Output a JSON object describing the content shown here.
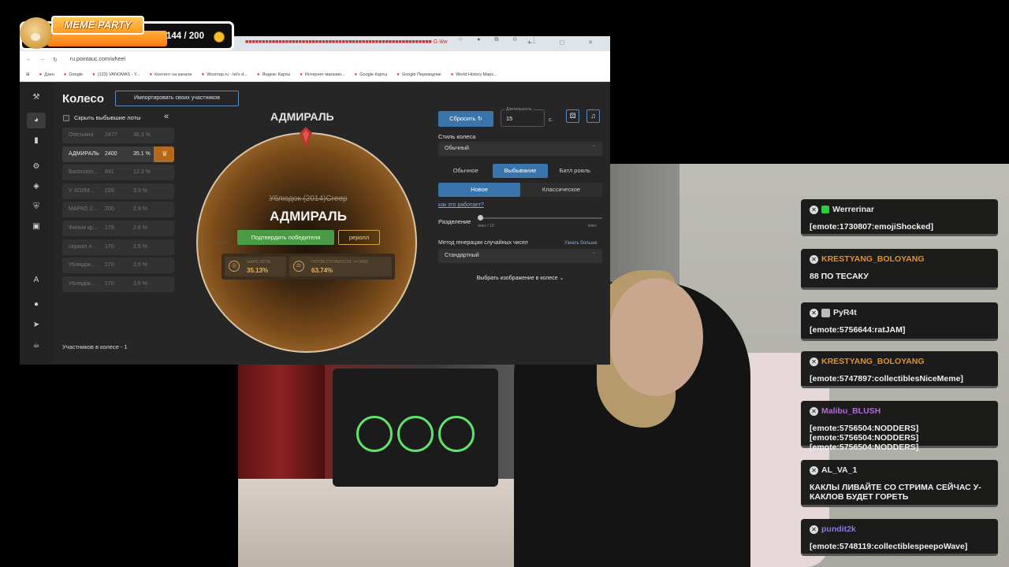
{
  "overlay": {
    "meme_party": {
      "title": "MEME PARTY",
      "score": "144 / 200"
    }
  },
  "browser": {
    "tabs_strip": "■■■■■■■■■■■■■■■■■■■■■■■■■■■■■■■■■■■■■■■■■■■■■■■■■■■■■■■■ G·ww",
    "new_tab": "+",
    "window_buttons": "— ▢ ✕",
    "url": "ru.pointauc.com/wheel",
    "toolbar_icons": "⋯ ☆ ● ⧉ ⊙ ⋮",
    "bookmarks": [
      "Дзен",
      "Google",
      "(123) VANOMAS - Y...",
      "Контент на канале",
      "Wozmap.ru - let's d...",
      "Яндекс Карты",
      "Интернет-магазин...",
      "Google Карты",
      "Google Переводчик",
      "World History Maps..."
    ]
  },
  "app": {
    "title": "Колесо",
    "import_button": "Импортировать своих участников",
    "hide_dropped": "Скрыть выбывшие лоты",
    "collapse": "«",
    "lots": [
      {
        "name": "Обезьяна",
        "amount": "2477",
        "percent": "36.3 %",
        "dropped": true
      },
      {
        "name": "АДМИРАЛЬ",
        "amount": "2400",
        "percent": "35.1 %",
        "dropped": false
      },
      {
        "name": "Backroom...",
        "amount": "841",
        "percent": "12.3 %",
        "dropped": true
      },
      {
        "name": "У ХОЛМ...",
        "amount": "228",
        "percent": "3.3 %",
        "dropped": true
      },
      {
        "name": "МАРКО 2...",
        "amount": "200",
        "percent": "2.9 %",
        "dropped": true
      },
      {
        "name": "Фильм кр...",
        "amount": "179",
        "percent": "2.6 %",
        "dropped": true
      },
      {
        "name": "сериал л...",
        "amount": "170",
        "percent": "2.5 %",
        "dropped": true
      },
      {
        "name": "Ублюдок...",
        "amount": "170",
        "percent": "2.5 %",
        "dropped": true
      },
      {
        "name": "Ублюдок...",
        "amount": "170",
        "percent": "2.5 %",
        "dropped": true
      }
    ],
    "participants_count": "Участников в колесе - 1",
    "wheel": {
      "winner_title": "АДМИРАЛЬ",
      "previous": "Ублюдок (2014)Creep",
      "winner_name": "АДМИРАЛЬ",
      "confirm_button": "Подтвердить победителя",
      "reroll_button": "реролл",
      "side_label": "ЧАЛМИ...",
      "lot_chance_label": "ШАНС ЛОТА",
      "lot_chance_value": "35.13%",
      "loss_label": "ПОТОК СТОИМОСТИ: >= 2400",
      "loss_value": "63.74%"
    },
    "settings": {
      "reset_button": "Сбросить",
      "duration_label": "Длительность",
      "duration_value": "15",
      "duration_unit": "с.",
      "wheel_style_label": "Стиль колеса",
      "wheel_style_value": "Обычный",
      "modes": [
        "Обычное",
        "Выбывание",
        "Батл рояль"
      ],
      "active_mode": 1,
      "variants": [
        "Новое",
        "Классическое"
      ],
      "active_variant": 0,
      "how_it_works": "как это работает?",
      "split_label": "Разделение",
      "split_min": "макс / 10",
      "split_max": "макс",
      "split_value": 0,
      "rng_label": "Метод генерации случайных чисел",
      "learn_more": "Узнать больше",
      "rng_value": "Стандартный",
      "pick_image": "Выбрать изображение в колесе  ⌄"
    }
  },
  "chat": [
    {
      "user": "Werrerinar",
      "color": "#e8e8e8",
      "badge": "green",
      "text": "[emote:1730807:emojiShocked]"
    },
    {
      "user": "KRESTYANG_BOLOYANG",
      "color": "#e0912e",
      "badge": "",
      "text": "88 ПО ТЕСАКУ"
    },
    {
      "user": "PyR4t",
      "color": "#e8e8e8",
      "badge": "gray",
      "text": "[emote:5756644:ratJAM]"
    },
    {
      "user": "KRESTYANG_BOLOYANG",
      "color": "#e0912e",
      "badge": "",
      "text": "[emote:5747897:collectiblesNiceMeme]"
    },
    {
      "user": "Malibu_BLUSH",
      "color": "#b06ad8",
      "badge": "",
      "text": "[emote:5756504:NODDERS][emote:5756504:NODDERS][emote:5756504:NODDERS]"
    },
    {
      "user": "AL_VA_1",
      "color": "#e8e8e8",
      "badge": "",
      "text": "КАКЛЫ ЛИВАЙТЕ СО СТРИМА СЕЙЧАС У-КАКЛОВ БУДЕТ ГОРЕТЬ"
    },
    {
      "user": "pundit2k",
      "color": "#8a7ae0",
      "badge": "",
      "text": "[emote:5748119:collectiblespeepoWave]"
    }
  ]
}
